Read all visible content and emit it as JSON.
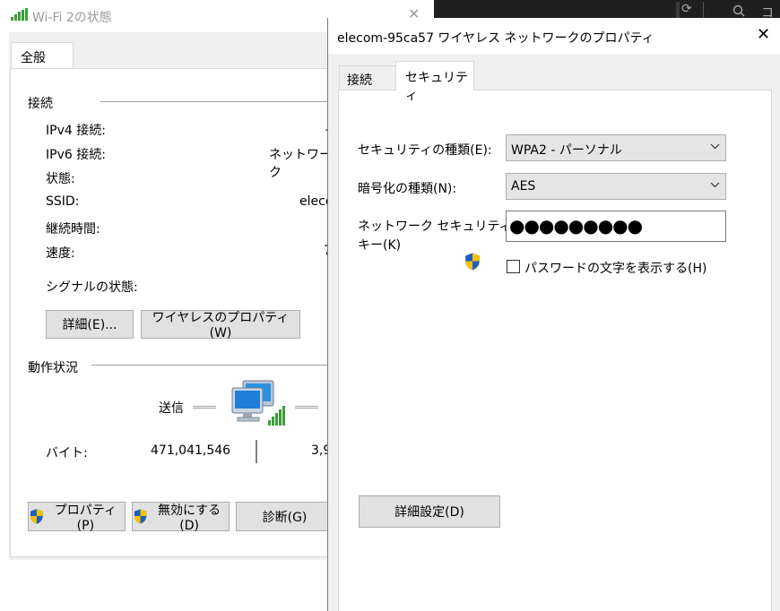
{
  "background": {
    "taskbar_icons": [
      "refresh-icon",
      "search-icon"
    ],
    "partial_text": "コ"
  },
  "status_window": {
    "title": "Wi-Fi 2の状態",
    "close_glyph": "✕",
    "tab": "全般",
    "connection_section": "接続",
    "rows": [
      {
        "label": "IPv4 接続:",
        "value": "イ"
      },
      {
        "label": "IPv6 接続:",
        "value": "ネットワーク"
      },
      {
        "label": "状態:",
        "value": ""
      },
      {
        "label": "SSID:",
        "value": "eleco"
      },
      {
        "label": "継続時間:",
        "value": ""
      },
      {
        "label": "速度:",
        "value": "7"
      }
    ],
    "signal_label": "シグナルの状態:",
    "details_button": "詳細(E)...",
    "wireless_props_button": "ワイヤレスのプロパティ(W)",
    "activity_section": "動作状況",
    "sent_label": "送信",
    "bytes_label": "バイト:",
    "bytes_sent": "471,041,546",
    "bytes_received": "3,9",
    "properties_button": "プロパティ(P)",
    "disable_button": "無効にする(D)",
    "diagnose_button": "診断(G)"
  },
  "props_window": {
    "title": "elecom-95ca57 ワイヤレス ネットワークのプロパティ",
    "close_glyph": "✕",
    "tabs": {
      "connection": "接続",
      "security": "セキュリティ"
    },
    "security_type_label": "セキュリティの種類(E):",
    "security_type_value": "WPA2 - パーソナル",
    "encryption_type_label": "暗号化の種類(N):",
    "encryption_type_value": "AES",
    "network_key_label_line1": "ネットワーク セキュリティ",
    "network_key_label_line2": "キー(K)",
    "network_key_value": "●●●●●●●●●",
    "show_chars_label": "パスワードの文字を表示する(H)",
    "show_chars_checked": false,
    "advanced_button": "詳細設定(D)"
  },
  "colors": {
    "signal_green": "#3c9e36",
    "shield_blue": "#1f5fbf",
    "shield_yellow": "#f2c200",
    "dialog_bg": "#f0f0f0",
    "button_bg": "#e1e1e1"
  }
}
